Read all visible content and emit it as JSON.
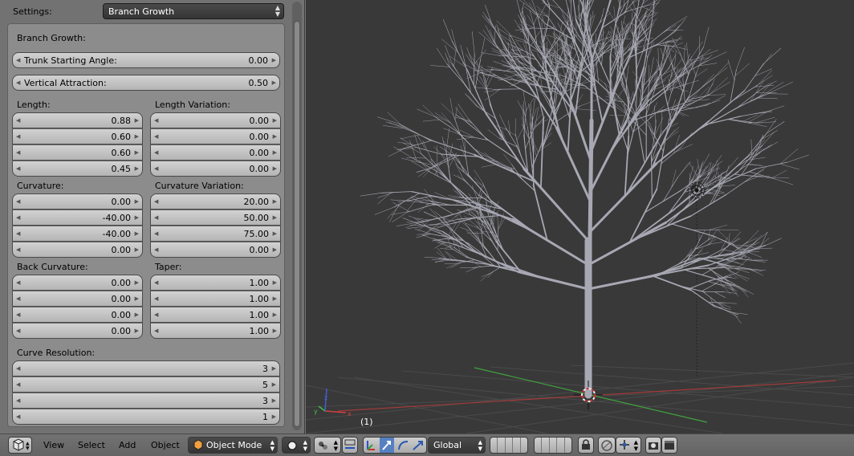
{
  "settings": {
    "label": "Settings:",
    "value": "Branch Growth"
  },
  "panel": {
    "section_title": "Branch Growth:",
    "trunk_angle": {
      "label": "Trunk Starting Angle:",
      "value": "0.00"
    },
    "vertical_attraction": {
      "label": "Vertical Attraction:",
      "value": "0.50"
    },
    "length": {
      "label": "Length:",
      "values": [
        "0.88",
        "0.60",
        "0.60",
        "0.45"
      ]
    },
    "length_variation": {
      "label": "Length Variation:",
      "values": [
        "0.00",
        "0.00",
        "0.00",
        "0.00"
      ]
    },
    "curvature": {
      "label": "Curvature:",
      "values": [
        "0.00",
        "-40.00",
        "-40.00",
        "0.00"
      ]
    },
    "curvature_variation": {
      "label": "Curvature Variation:",
      "values": [
        "20.00",
        "50.00",
        "75.00",
        "0.00"
      ]
    },
    "back_curvature": {
      "label": "Back Curvature:",
      "values": [
        "0.00",
        "0.00",
        "0.00",
        "0.00"
      ]
    },
    "taper": {
      "label": "Taper:",
      "values": [
        "1.00",
        "1.00",
        "1.00",
        "1.00"
      ]
    },
    "curve_resolution": {
      "label": "Curve Resolution:",
      "values": [
        "3",
        "5",
        "3",
        "1"
      ]
    }
  },
  "viewport": {
    "frame_label": "(1)"
  },
  "header": {
    "menus": {
      "view": "View",
      "select": "Select",
      "add": "Add",
      "object": "Object"
    },
    "mode": "Object Mode",
    "orientation": "Global"
  },
  "icons": {
    "editor_type": "cube-icon",
    "mode": "object-mode-cube-icon",
    "shading": "solid-sphere-icon",
    "pivot": "pivot-point-icon",
    "manipulator": "manipulator-icon",
    "render": "render-icon"
  },
  "colors": {
    "panel_bg": "#727272",
    "viewport_bg": "#393939",
    "grid_x_axis": "#a33b3b",
    "grid_y_axis": "#3fa33f",
    "tree": "#a8a8b4",
    "active_blue": "#5680c2"
  }
}
